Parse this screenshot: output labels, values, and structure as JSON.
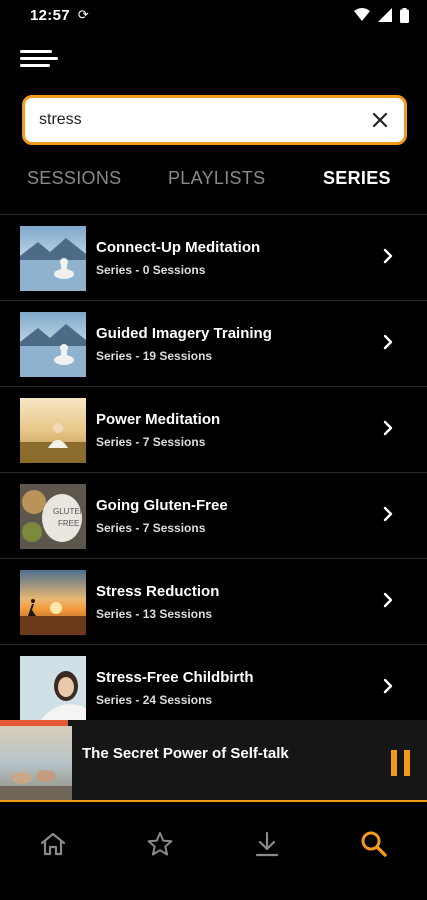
{
  "status_bar": {
    "time": "12:57",
    "sync_glyph": "⟳"
  },
  "search": {
    "value": "stress",
    "placeholder": ""
  },
  "tabs": [
    {
      "label": "SESSIONS",
      "active": false
    },
    {
      "label": "PLAYLISTS",
      "active": false
    },
    {
      "label": "SERIES",
      "active": true
    }
  ],
  "results": [
    {
      "title": "Connect-Up Meditation",
      "subtitle": "Series - 0 Sessions",
      "thumb": "lake-meditation"
    },
    {
      "title": "Guided Imagery Training",
      "subtitle": "Series - 19 Sessions",
      "thumb": "lake-meditation"
    },
    {
      "title": "Power Meditation",
      "subtitle": "Series - 7 Sessions",
      "thumb": "field-meditation"
    },
    {
      "title": "Going Gluten-Free",
      "subtitle": "Series - 7 Sessions",
      "thumb": "gluten-free-food"
    },
    {
      "title": "Stress Reduction",
      "subtitle": "Series - 13 Sessions",
      "thumb": "sunset-runner"
    },
    {
      "title": "Stress-Free Childbirth",
      "subtitle": "Series - 24 Sessions",
      "thumb": "smiling-woman"
    }
  ],
  "player": {
    "title": "The Secret Power of Self-talk",
    "progress": 0.16,
    "thumb": "feet-on-beach"
  },
  "nav": [
    {
      "name": "home",
      "active": false
    },
    {
      "name": "favorites",
      "active": false
    },
    {
      "name": "downloads",
      "active": false
    },
    {
      "name": "search",
      "active": true
    }
  ],
  "colors": {
    "accent": "#f39a1d",
    "progress": "#e55a3a",
    "background": "#000000",
    "inactive": "#8a8a8a"
  }
}
